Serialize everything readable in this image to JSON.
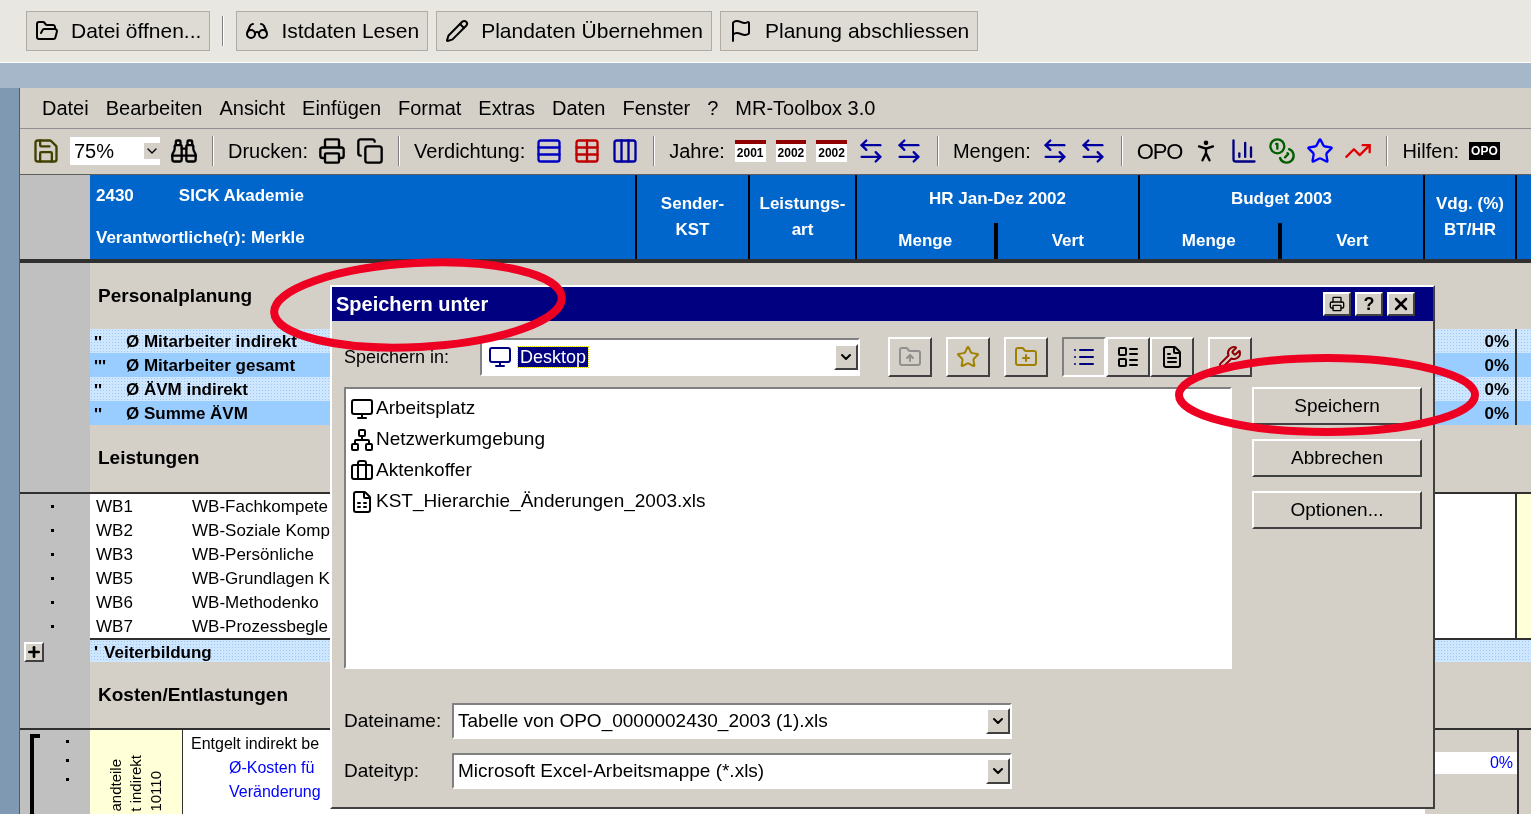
{
  "app_toolbar": [
    {
      "label": "Datei öffnen...",
      "kind": "folder"
    },
    {
      "label": "Istdaten Lesen",
      "kind": "glasses"
    },
    {
      "label": "Plandaten Übernehmen",
      "kind": "pencil"
    },
    {
      "label": "Planung abschliessen",
      "kind": "flag"
    }
  ],
  "menu": [
    "Datei",
    "Bearbeiten",
    "Ansicht",
    "Einfügen",
    "Format",
    "Extras",
    "Daten",
    "Fenster",
    "?",
    "MR-Toolbox 3.0"
  ],
  "toolbar": {
    "zoom": "75%",
    "print_label": "Drucken:",
    "density_label": "Verdichtung:",
    "years_label": "Jahre:",
    "year_icons": [
      "2001",
      "2002",
      "2002"
    ],
    "quantities_label": "Mengen:",
    "opo_icon": "OPO",
    "help_label": "Hilfen:",
    "help_icon": "OPO"
  },
  "header": {
    "code": "2430",
    "name": "SICK Akademie",
    "responsible": "Verantwortliche(r): Merkle",
    "sender": [
      "Sender-",
      "KST"
    ],
    "service_type": [
      "Leistungs-",
      "art"
    ],
    "groups": [
      {
        "title": "HR Jan-Dez 2002",
        "columns": [
          "Menge",
          "Vert"
        ]
      },
      {
        "title": "Budget 2003",
        "columns": [
          "Menge",
          "Vert"
        ]
      }
    ],
    "change": [
      "Vdg. (%)",
      "BT/HR"
    ]
  },
  "sections": [
    {
      "kind": "summary",
      "title": "Personalplanung",
      "rows": [
        {
          "kind": "dotted",
          "marker": "''",
          "label": "Ø Mitarbeiter indirekt",
          "change": "0%"
        },
        {
          "kind": "solid",
          "marker": "'''",
          "label": "Ø Mitarbeiter gesamt",
          "change": "0%"
        },
        {
          "kind": "dotted",
          "marker": "''",
          "label": "Ø ÄVM indirekt",
          "change": "0%"
        },
        {
          "kind": "solid",
          "marker": "''",
          "label": "Ø Summe ÄVM",
          "change": "0%"
        }
      ]
    },
    {
      "kind": "services",
      "title": "Leistungen",
      "rows": [
        {
          "code": "WB1",
          "name": "WB-Fachkompete"
        },
        {
          "code": "WB2",
          "name": "WB-Soziale Komp"
        },
        {
          "code": "WB3",
          "name": "WB-Persönliche"
        },
        {
          "code": "WB5",
          "name": "WB-Grundlagen K"
        },
        {
          "code": "WB6",
          "name": "WB-Methodenko"
        },
        {
          "code": "WB7",
          "name": "WB-Prozessbegle"
        }
      ],
      "total": {
        "marker": "'",
        "label": "Veiterbildung",
        "expanded": false
      }
    },
    {
      "kind": "costs",
      "title": "Kosten/Entlastungen",
      "side_label": [
        "andteile",
        "t indirekt",
        "10110"
      ],
      "rows": [
        {
          "kind": "plain",
          "label": "Entgelt indirekt be"
        },
        {
          "kind": "link",
          "label": "Ø-Kosten fü"
        },
        {
          "kind": "link",
          "label": "Veränderung"
        }
      ],
      "change": "0%"
    }
  ],
  "dialog": {
    "title": "Speichern unter",
    "help_glyph": "?",
    "location_label": "Speichern in:",
    "location": "Desktop",
    "files": [
      {
        "name": "Arbeitsplatz",
        "kind": "computer"
      },
      {
        "name": "Netzwerkumgebung",
        "kind": "network"
      },
      {
        "name": "Aktenkoffer",
        "kind": "briefcase"
      },
      {
        "name": "KST_Hierarchie_Änderungen_2003.xls",
        "kind": "excel"
      }
    ],
    "buttons": [
      "Speichern",
      "Abbrechen",
      "Optionen..."
    ],
    "filename_label": "Dateiname:",
    "filename": "Tabelle von OPO_0000002430_2003 (1).xls",
    "filetype_label": "Dateityp:",
    "filetype": "Microsoft Excel-Arbeitsmappe (*.xls)"
  }
}
